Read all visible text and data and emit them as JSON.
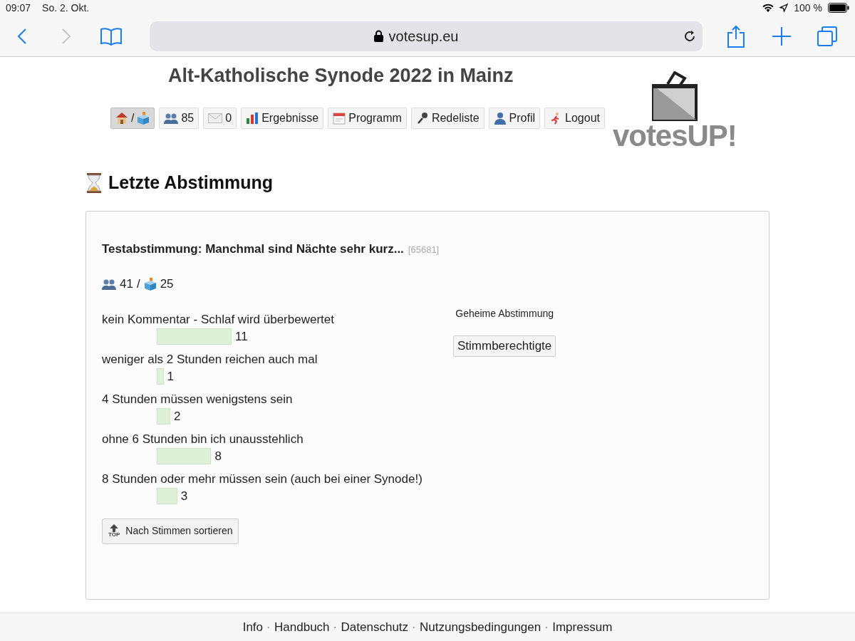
{
  "status_bar": {
    "time": "09:07",
    "date": "So. 2. Okt.",
    "battery": "100 %"
  },
  "browser": {
    "url": "votesup.eu"
  },
  "site": {
    "title": "Alt-Katholische Synode 2022 in Mainz",
    "logo": "votesUP!"
  },
  "nav": [
    {
      "kind": "home",
      "label": "/",
      "selected": true
    },
    {
      "kind": "people",
      "label": "85",
      "selected": false
    },
    {
      "kind": "mail",
      "label": "0",
      "selected": false
    },
    {
      "kind": "chart",
      "label": "Ergebnisse",
      "selected": false
    },
    {
      "kind": "calendar",
      "label": "Programm",
      "selected": false
    },
    {
      "kind": "mic",
      "label": "Redeliste",
      "selected": false
    },
    {
      "kind": "person",
      "label": "Profil",
      "selected": false
    },
    {
      "kind": "runner",
      "label": "Logout",
      "selected": false
    }
  ],
  "section": {
    "heading": "Letzte Abstimmung"
  },
  "poll": {
    "question": "Testabstimmung: Manchmal sind Nächte sehr kurz...",
    "id": "[65681]",
    "voters": "41",
    "ballots": "25",
    "separator": "/",
    "secret_label": "Geheime Abstimmung",
    "eligible_button": "Stimmberechtigte",
    "options": [
      {
        "label": "kein Kommentar - Schlaf wird überbewertet",
        "count": "11"
      },
      {
        "label": "weniger als 2 Stunden reichen auch mal",
        "count": "1"
      },
      {
        "label": "4 Stunden müssen wenigstens sein",
        "count": "2"
      },
      {
        "label": "ohne 6 Stunden bin ich unausstehlich",
        "count": "8"
      },
      {
        "label": "8 Stunden oder mehr müssen sein (auch bei einer Synode!)",
        "count": "3"
      }
    ],
    "sort_button": {
      "icon_text": "TOP",
      "label": "Nach Stimmen sortieren"
    }
  },
  "footer_separator": "·",
  "footer": [
    "Info",
    "Handbuch",
    "Datenschutz",
    "Nutzungsbedingungen",
    "Impressum"
  ]
}
